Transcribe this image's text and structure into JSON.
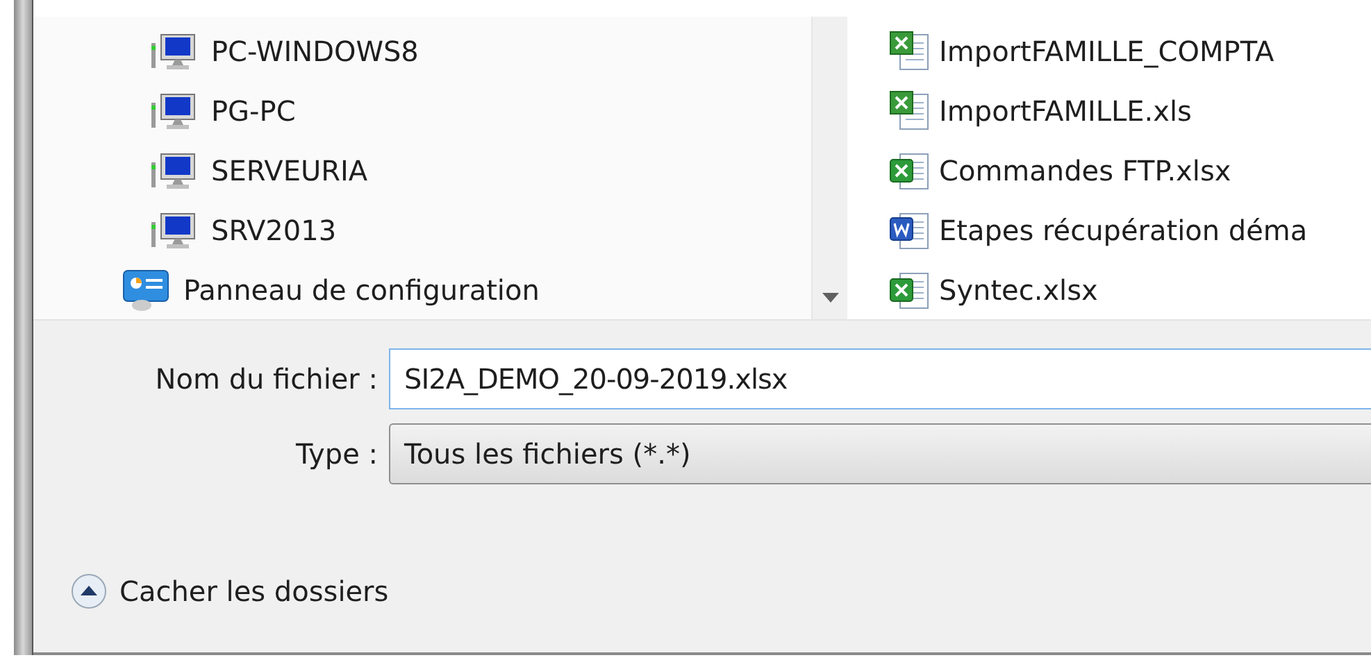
{
  "navigation": [
    {
      "kind": "computer",
      "label": "PC-WINDOWS8"
    },
    {
      "kind": "computer",
      "label": "PG-PC"
    },
    {
      "kind": "computer",
      "label": "SERVEURIA"
    },
    {
      "kind": "computer",
      "label": "SRV2013"
    },
    {
      "kind": "control-panel",
      "label": "Panneau de configuration"
    }
  ],
  "files": [
    {
      "kind": "excel-old",
      "name": "ImportFAMILLE_COMPTA"
    },
    {
      "kind": "excel-old",
      "name": "ImportFAMILLE.xls"
    },
    {
      "kind": "excel",
      "name": "Commandes FTP.xlsx"
    },
    {
      "kind": "word",
      "name": "Etapes récupération déma"
    },
    {
      "kind": "excel",
      "name": "Syntec.xlsx"
    }
  ],
  "filename": {
    "label": "Nom du fichier :",
    "value": "SI2A_DEMO_20-09-2019.xlsx"
  },
  "type": {
    "label": "Type :",
    "value": "Tous les fichiers (*.*)"
  },
  "folders_toggle": {
    "label": "Cacher les dossiers"
  }
}
